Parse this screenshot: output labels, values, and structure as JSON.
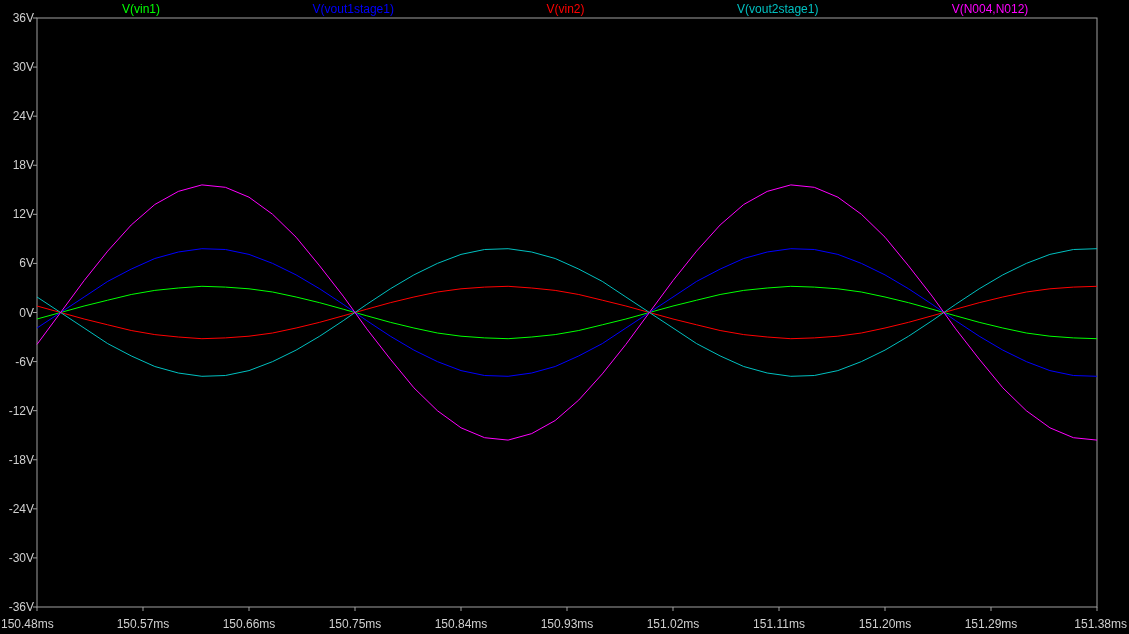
{
  "plot": {
    "chart_data": {
      "type": "line",
      "x": [
        150.48,
        150.5,
        150.52,
        150.54,
        150.56,
        150.58,
        150.6,
        150.62,
        150.64,
        150.66,
        150.68,
        150.7,
        150.72,
        150.74,
        150.76,
        150.78,
        150.8,
        150.82,
        150.84,
        150.86,
        150.88,
        150.9,
        150.92,
        150.94,
        150.96,
        150.98,
        151.0,
        151.02,
        151.04,
        151.06,
        151.08,
        151.1,
        151.12,
        151.14,
        151.16,
        151.18,
        151.2,
        151.22,
        151.24,
        151.26,
        151.28,
        151.3,
        151.32,
        151.34,
        151.36,
        151.38
      ],
      "series": [
        {
          "name": "V(vin1)",
          "color": "#00ff00",
          "values": [
            -0.8,
            0,
            0.8,
            1.5,
            2.2,
            2.7,
            3.0,
            3.2,
            3.1,
            2.9,
            2.5,
            1.9,
            1.2,
            0.4,
            -0.4,
            -1.2,
            -1.9,
            -2.5,
            -2.9,
            -3.1,
            -3.2,
            -3.0,
            -2.7,
            -2.2,
            -1.5,
            -0.8,
            0,
            0.8,
            1.5,
            2.2,
            2.7,
            3.0,
            3.2,
            3.1,
            2.9,
            2.5,
            1.9,
            1.2,
            0.4,
            -0.4,
            -1.2,
            -1.9,
            -2.5,
            -2.9,
            -3.1,
            -3.2
          ]
        },
        {
          "name": "V(vout1stage1)",
          "color": "#0000ff",
          "values": [
            -1.9,
            0,
            1.9,
            3.8,
            5.3,
            6.6,
            7.4,
            7.8,
            7.7,
            7.1,
            6.0,
            4.6,
            2.9,
            1.0,
            -1.0,
            -2.9,
            -4.6,
            -6.0,
            -7.1,
            -7.7,
            -7.8,
            -7.4,
            -6.6,
            -5.3,
            -3.8,
            -1.9,
            0,
            1.9,
            3.8,
            5.3,
            6.6,
            7.4,
            7.8,
            7.7,
            7.1,
            6.0,
            4.6,
            2.9,
            1.0,
            -1.0,
            -2.9,
            -4.6,
            -6.0,
            -7.1,
            -7.7,
            -7.8
          ]
        },
        {
          "name": "V(vin2)",
          "color": "#ff0000",
          "values": [
            0.8,
            0,
            -0.8,
            -1.5,
            -2.2,
            -2.7,
            -3.0,
            -3.2,
            -3.1,
            -2.9,
            -2.5,
            -1.9,
            -1.2,
            -0.4,
            0.4,
            1.2,
            1.9,
            2.5,
            2.9,
            3.1,
            3.2,
            3.0,
            2.7,
            2.2,
            1.5,
            0.8,
            0,
            -0.8,
            -1.5,
            -2.2,
            -2.7,
            -3.0,
            -3.2,
            -3.1,
            -2.9,
            -2.5,
            -1.9,
            -1.2,
            -0.4,
            0.4,
            1.2,
            1.9,
            2.5,
            2.9,
            3.1,
            3.2
          ]
        },
        {
          "name": "V(vout2stage1)",
          "color": "#00c0c0",
          "values": [
            1.9,
            0,
            -1.9,
            -3.8,
            -5.3,
            -6.6,
            -7.4,
            -7.8,
            -7.7,
            -7.1,
            -6.0,
            -4.6,
            -2.9,
            -1.0,
            1.0,
            2.9,
            4.6,
            6.0,
            7.1,
            7.7,
            7.8,
            7.4,
            6.6,
            5.3,
            3.8,
            1.9,
            0,
            -1.9,
            -3.8,
            -5.3,
            -6.6,
            -7.4,
            -7.8,
            -7.7,
            -7.1,
            -6.0,
            -4.6,
            -2.9,
            -1.0,
            1.0,
            2.9,
            4.6,
            6.0,
            7.1,
            7.7,
            7.8
          ]
        },
        {
          "name": "V(N004,N012)",
          "color": "#ff00ff",
          "values": [
            -3.9,
            0,
            3.9,
            7.5,
            10.7,
            13.2,
            14.8,
            15.6,
            15.3,
            14.1,
            12.0,
            9.2,
            5.7,
            2.0,
            -2.0,
            -5.7,
            -9.2,
            -12.0,
            -14.1,
            -15.3,
            -15.6,
            -14.8,
            -13.2,
            -10.7,
            -7.5,
            -3.9,
            0,
            3.9,
            7.5,
            10.7,
            13.2,
            14.8,
            15.6,
            15.3,
            14.1,
            12.0,
            9.2,
            5.7,
            2.0,
            -2.0,
            -5.7,
            -9.2,
            -12.0,
            -14.1,
            -15.3,
            -15.6
          ]
        }
      ],
      "xlim": [
        150.48,
        151.38
      ],
      "ylim": [
        -36,
        36
      ],
      "xticks": [
        {
          "value": 150.48,
          "label": "150.48ms"
        },
        {
          "value": 150.57,
          "label": "150.57ms"
        },
        {
          "value": 150.66,
          "label": "150.66ms"
        },
        {
          "value": 150.75,
          "label": "150.75ms"
        },
        {
          "value": 150.84,
          "label": "150.84ms"
        },
        {
          "value": 150.93,
          "label": "150.93ms"
        },
        {
          "value": 151.02,
          "label": "151.02ms"
        },
        {
          "value": 151.11,
          "label": "151.11ms"
        },
        {
          "value": 151.2,
          "label": "151.20ms"
        },
        {
          "value": 151.29,
          "label": "151.29ms"
        },
        {
          "value": 151.38,
          "label": "151.38ms"
        }
      ],
      "yticks": [
        {
          "value": 36,
          "label": "36V"
        },
        {
          "value": 30,
          "label": "30V"
        },
        {
          "value": 24,
          "label": "24V"
        },
        {
          "value": 18,
          "label": "18V"
        },
        {
          "value": 12,
          "label": "12V"
        },
        {
          "value": 6,
          "label": "6V"
        },
        {
          "value": 0,
          "label": "0V"
        },
        {
          "value": -6,
          "label": "-6V"
        },
        {
          "value": -12,
          "label": "-12V"
        },
        {
          "value": -18,
          "label": "-18V"
        },
        {
          "value": -24,
          "label": "-24V"
        },
        {
          "value": -30,
          "label": "-30V"
        },
        {
          "value": -36,
          "label": "-36V"
        }
      ]
    }
  }
}
